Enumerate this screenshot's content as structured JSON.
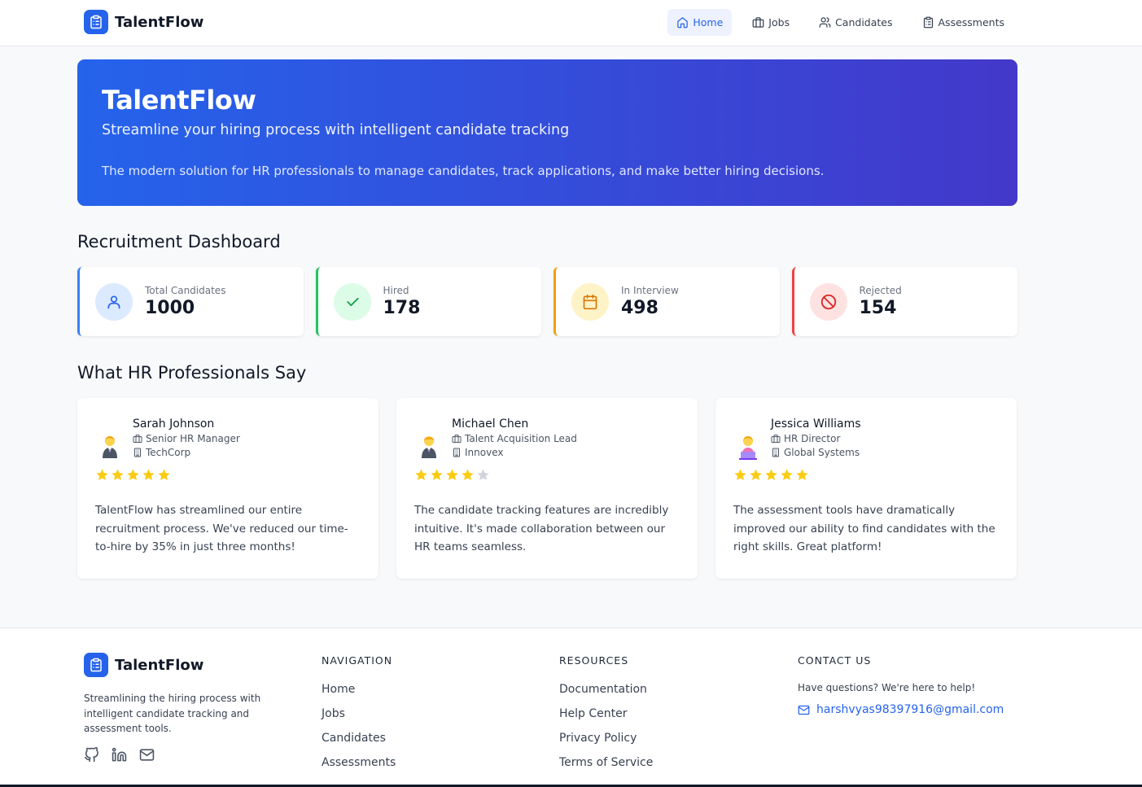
{
  "app": {
    "name": "TalentFlow"
  },
  "nav": {
    "items": [
      {
        "label": "Home",
        "icon": "home-icon",
        "active": true
      },
      {
        "label": "Jobs",
        "icon": "briefcase-icon",
        "active": false
      },
      {
        "label": "Candidates",
        "icon": "users-icon",
        "active": false
      },
      {
        "label": "Assessments",
        "icon": "clipboard-icon",
        "active": false
      }
    ]
  },
  "hero": {
    "title": "TalentFlow",
    "subtitle": "Streamline your hiring process with intelligent candidate tracking",
    "description": "The modern solution for HR professionals to manage candidates, track applications, and make better hiring decisions."
  },
  "dashboard": {
    "title": "Recruitment Dashboard",
    "stats": [
      {
        "label": "Total Candidates",
        "value": "1000",
        "icon": "user-icon",
        "accent": "#3b82f6"
      },
      {
        "label": "Hired",
        "value": "178",
        "icon": "check-icon",
        "accent": "#22c55e"
      },
      {
        "label": "In Interview",
        "value": "498",
        "icon": "calendar-icon",
        "accent": "#f59e0b"
      },
      {
        "label": "Rejected",
        "value": "154",
        "icon": "ban-icon",
        "accent": "#ef4444"
      }
    ]
  },
  "testimonials": {
    "title": "What HR Professionals Say",
    "items": [
      {
        "name": "Sarah Johnson",
        "role": "Senior HR Manager",
        "company": "TechCorp",
        "rating": 5,
        "avatar": "businesswoman-emoji",
        "quote": "TalentFlow has streamlined our entire recruitment process. We've reduced our time-to-hire by 35% in just three months!"
      },
      {
        "name": "Michael Chen",
        "role": "Talent Acquisition Lead",
        "company": "Innovex",
        "rating": 4,
        "avatar": "businessman-emoji",
        "quote": "The candidate tracking features are incredibly intuitive. It's made collaboration between our HR teams seamless."
      },
      {
        "name": "Jessica Williams",
        "role": "HR Director",
        "company": "Global Systems",
        "rating": 5,
        "avatar": "woman-laptop-emoji",
        "quote": "The assessment tools have dramatically improved our ability to find candidates with the right skills. Great platform!"
      }
    ]
  },
  "footer": {
    "brand": "TalentFlow",
    "description": "Streamlining the hiring process with intelligent candidate tracking and assessment tools.",
    "social": [
      "github-icon",
      "linkedin-icon",
      "mail-icon"
    ],
    "navigation": {
      "heading": "NAVIGATION",
      "links": [
        "Home",
        "Jobs",
        "Candidates",
        "Assessments"
      ]
    },
    "resources": {
      "heading": "RESOURCES",
      "links": [
        "Documentation",
        "Help Center",
        "Privacy Policy",
        "Terms of Service"
      ]
    },
    "contact": {
      "heading": "CONTACT US",
      "text": "Have questions? We're here to help!",
      "email": "harshvyas98397916@gmail.com"
    }
  },
  "colors": {
    "brand": "#2563eb",
    "hero_start": "#2563eb",
    "hero_end": "#4338ca",
    "star": "#facc15",
    "star_empty": "#d1d5db"
  }
}
